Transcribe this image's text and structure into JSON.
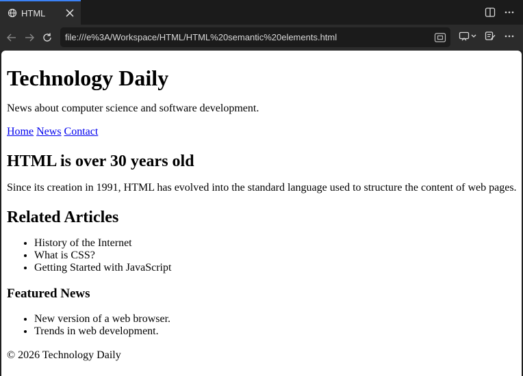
{
  "tab": {
    "title": "HTML",
    "icon": "globe-icon"
  },
  "address_bar": {
    "url": "file:///e%3A/Workspace/HTML/HTML%20semantic%20elements.html"
  },
  "page": {
    "site_title": "Technology Daily",
    "tagline": "News about computer science and software development.",
    "nav_links": [
      "Home",
      "News",
      "Contact"
    ],
    "article": {
      "heading": "HTML is over 30 years old",
      "body": "Since its creation in 1991, HTML has evolved into the standard language used to structure the content of web pages."
    },
    "related": {
      "heading": "Related Articles",
      "items": [
        "History of the Internet",
        "What is CSS?",
        "Getting Started with JavaScript"
      ]
    },
    "featured": {
      "heading": "Featured News",
      "items": [
        "New version of a web browser.",
        "Trends in web development."
      ]
    },
    "footer": "© 2026 Technology Daily"
  },
  "colors": {
    "link": "#0000ee",
    "tab_accent": "#3b82f6",
    "chrome_dark": "#1b1b1b",
    "chrome": "#2b2b2b"
  }
}
